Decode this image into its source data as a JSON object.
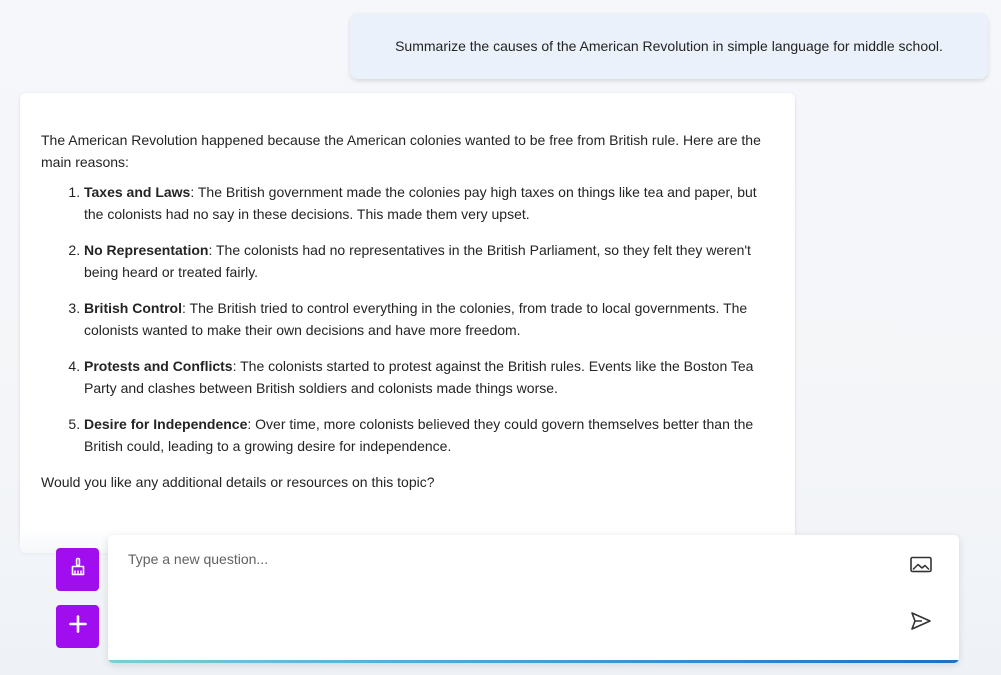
{
  "conversation": {
    "user_message": "Summarize the causes of the American Revolution in simple language for middle school.",
    "assistant": {
      "intro": "The American Revolution happened because the American colonies wanted to be free from British rule. Here are the main reasons:",
      "reasons": [
        {
          "title": "Taxes and Laws",
          "text": ": The British government made the colonies pay high taxes on things like tea and paper, but the colonists had no say in these decisions. This made them very upset."
        },
        {
          "title": "No Representation",
          "text": ": The colonists had no representatives in the British Parliament, so they felt they weren't being heard or treated fairly."
        },
        {
          "title": "British Control",
          "text": ": The British tried to control everything in the colonies, from trade to local governments. The colonists wanted to make their own decisions and have more freedom."
        },
        {
          "title": "Protests and Conflicts",
          "text": ": The colonists started to protest against the British rules. Events like the Boston Tea Party and clashes between British soldiers and colonists made things worse."
        },
        {
          "title": "Desire for Independence",
          "text": ": Over time, more colonists believed they could govern themselves better than the British could, leading to a growing desire for independence."
        }
      ],
      "closing": "Would you like any additional details or resources on this topic?"
    }
  },
  "composer": {
    "placeholder": "Type a new question...",
    "value": ""
  },
  "icons": {
    "clear_button": "broom-icon",
    "add_button": "plus-icon",
    "image_button": "image-icon",
    "send_button": "send-icon"
  },
  "colors": {
    "accent": "#a00ef0",
    "user_bubble": "#eaf1fa",
    "underline_start": "#7ad0d6",
    "underline_end": "#1f6fc4"
  }
}
